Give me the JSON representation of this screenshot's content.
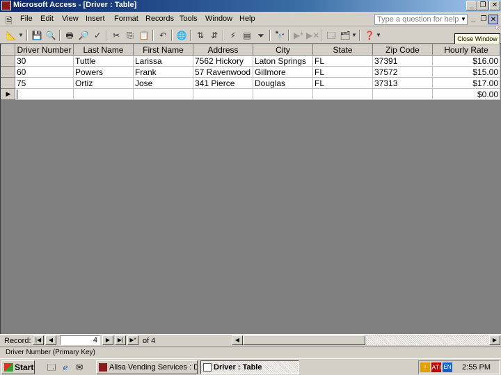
{
  "window": {
    "title": "Microsoft Access - [Driver : Table]",
    "minimize_icon": "minimize-icon",
    "restore_icon": "restore-icon",
    "close_icon": "close-icon"
  },
  "menu": {
    "items": [
      {
        "label": "File"
      },
      {
        "label": "Edit"
      },
      {
        "label": "View"
      },
      {
        "label": "Insert"
      },
      {
        "label": "Format"
      },
      {
        "label": "Records"
      },
      {
        "label": "Tools"
      },
      {
        "label": "Window"
      },
      {
        "label": "Help"
      }
    ],
    "ask_placeholder": "Type a question for help",
    "tooltip": "Close Window"
  },
  "table": {
    "columns": [
      "Driver Number",
      "Last Name",
      "First Name",
      "Address",
      "City",
      "State",
      "Zip Code",
      "Hourly Rate"
    ],
    "rows": [
      [
        "30",
        "Tuttle",
        "Larissa",
        "7562 Hickory",
        "Laton Springs",
        "FL",
        "37391",
        "$16.00"
      ],
      [
        "60",
        "Powers",
        "Frank",
        "57 Ravenwood",
        "Gillmore",
        "FL",
        "37572",
        "$15.00"
      ],
      [
        "75",
        "Ortiz",
        "Jose",
        "341 Pierce",
        "Douglas",
        "FL",
        "37313",
        "$17.00"
      ]
    ],
    "new_row_rate": "$0.00",
    "current_row_marker": "▶"
  },
  "record_nav": {
    "label": "Record:",
    "current": "4",
    "of_label": "of  4"
  },
  "status": {
    "text": "Driver Number (Primary Key)"
  },
  "taskbar": {
    "start_label": "Start",
    "buttons": [
      {
        "label": "Alisa Vending Services : D..."
      },
      {
        "label": "Driver : Table"
      }
    ],
    "clock": "2:55 PM"
  }
}
